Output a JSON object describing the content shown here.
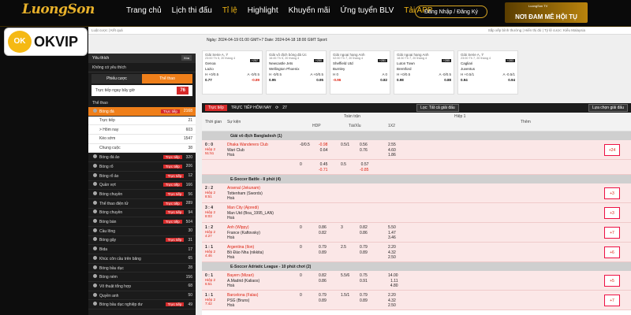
{
  "brand": {
    "logo": "LuongSon",
    "okvip": "OKVIP",
    "okvip_badge": "OK"
  },
  "nav": {
    "items": [
      "Trang chủ",
      "Lịch thi đấu",
      "Tỉ lệ",
      "Highlight",
      "Khuyến mãi",
      "Ứng tuyển BLV",
      "Tải APP"
    ],
    "active": "Tỉ lệ",
    "app_badge": "HOT",
    "login": "Đăng Nhập / Đăng Ký",
    "promo_small": "LuongSon TV",
    "promo": "NƠI ĐAM MÊ HỘI TỤ"
  },
  "breadcrumb": {
    "left": "Luật cược | Kết quả",
    "right": "Sắp xếp bình thường | Hiển thị đủ | Tỷ lệ cược: Kiểu Malaysia"
  },
  "dates": "Ngày: 2024-04-19 01:00 GMT+7 Date: 2024-04-18 18:00 GMT Sport:",
  "sidebar": {
    "fav": "Yêu thích",
    "close": "Xóa",
    "fav_none": "Không có yêu thích",
    "tabs": [
      "Phiếu cược",
      "Thể thao"
    ],
    "live_label": "Trực tiếp ngay bây giờ",
    "live_count": "76",
    "section": "Thể thao",
    "rows": [
      {
        "name": "Bóng đá",
        "tag": "Trực tiếp",
        "count": "2168",
        "sel": true
      },
      {
        "name": "Trực tiếp",
        "count": "21",
        "sub": true
      },
      {
        "name": "> Hôm nay",
        "count": "603",
        "sub": true
      },
      {
        "name": "Kèo sớm",
        "count": "1547",
        "sub": true
      },
      {
        "name": "Chung cuộc",
        "count": "38",
        "sub": true
      },
      {
        "name": "Bóng đá ảo",
        "tag": "Trực tiếp",
        "count": "320"
      },
      {
        "name": "Bóng rổ",
        "tag": "Trực tiếp",
        "count": "206"
      },
      {
        "name": "Bóng rổ ảo",
        "tag": "Trực tiếp",
        "count": "12"
      },
      {
        "name": "Quần vợt",
        "tag": "Trực tiếp",
        "count": "166"
      },
      {
        "name": "Bóng chuyền",
        "tag": "Trực tiếp",
        "count": "56"
      },
      {
        "name": "Thể thao điện tử",
        "tag": "Trực tiếp",
        "count": "289"
      },
      {
        "name": "Bóng chuyền",
        "tag": "Trực tiếp",
        "count": "94"
      },
      {
        "name": "Bóng bàn",
        "tag": "Trực tiếp",
        "count": "504"
      },
      {
        "name": "Cầu lông",
        "count": "30"
      },
      {
        "name": "Bóng gậy",
        "tag": "Trực tiếp",
        "count": "31"
      },
      {
        "name": "Bida",
        "count": "17"
      },
      {
        "name": "Khúc côn cầu trên băng",
        "count": "65"
      },
      {
        "name": "Bóng bầu dục",
        "count": "28"
      },
      {
        "name": "Bóng ném",
        "count": "156"
      },
      {
        "name": "Võ thuật tổng hợp",
        "count": "68"
      },
      {
        "name": "Quyền anh",
        "count": "50"
      },
      {
        "name": "Bóng bầu dục nghiệp dư",
        "tag": "Trực tiếp",
        "count": "49"
      }
    ]
  },
  "cards": [
    {
      "league": "Giải Serie A, Ý",
      "time": "23:00 Th 5, 20 tháng 4",
      "badge": "+257",
      "home": "Genoa",
      "away": "Lazio",
      "h": "H +0/0.5",
      "hv": "0.77",
      "a": "A -0/0.5",
      "av": "-0.89"
    },
    {
      "league": "Giải vô địch bóng đá Úc",
      "time": "16:45 Th 5, 20 tháng 4",
      "badge": "+250",
      "home": "Newcastle Jets",
      "away": "Wellington Phoenix",
      "h": "H -0/0.5",
      "hv": "0.95",
      "a": "A +0/0.5",
      "av": "0.95"
    },
    {
      "league": "Giải ngoại hạng Anh",
      "time": "02:00 Th 7, 20 tháng 4",
      "badge": "+281",
      "home": "Sheffield Utd",
      "away": "Burnley",
      "h": "H 0",
      "hv": "-0.96",
      "a": "A 0",
      "av": "0.82"
    },
    {
      "league": "Giải ngoại hạng Anh",
      "time": "18:30 Th 7, 20 tháng 4",
      "badge": "+285",
      "home": "Luton Town",
      "away": "Brentford",
      "h": "H +0/0.5",
      "hv": "0.98",
      "a": "A -0/0.5",
      "av": "0.88"
    },
    {
      "league": "Giải Serie A, Ý",
      "time": "23:00 Th 7, 20 tháng 4",
      "badge": "+283",
      "home": "Cagliari",
      "away": "Juventus",
      "h": "H +0.5/1",
      "hv": "0.94",
      "a": "A -0.5/1",
      "av": "0.94"
    }
  ],
  "table": {
    "live": "Trực tiếp",
    "today": "TRỰC TIẾP HÔM NAY",
    "count": "27",
    "filter": "Lọc: Tất cả giải đấu",
    "select": "Lựa chọn giải đấu",
    "cols": {
      "time": "Thời gian",
      "event": "Sự kiện",
      "full": "Toàn trận",
      "half": "Hiệp 1",
      "hdp": "HDP",
      "ou": "Tài/Xỉu",
      "x12": "1X2",
      "more": "Thêm"
    },
    "groups": [
      {
        "league": "Giải vô địch Bangladesh (1)",
        "matches": [
          {
            "score": "0 : 0",
            "status": "Hiệp 2",
            "minute": "51:51",
            "home": "Dhaka Wanderers Club",
            "away": "Wari Club",
            "draw": "Hoà",
            "hdp": "-0/0.5",
            "hdp_v": [
              "-0.98",
              "0.64"
            ],
            "ou": "0.5/1",
            "ou_v": [
              "0.56",
              "0.76"
            ],
            "x": [
              "2.55",
              "4.60",
              "1.86"
            ],
            "more": "+24"
          },
          {
            "score": "",
            "status": "",
            "minute": "",
            "home": "",
            "away": "",
            "draw": "",
            "hdp": "0",
            "hdp_v": [
              "0.45",
              "-0.71"
            ],
            "ou": "0.5",
            "ou_v": [
              "0.57",
              "-0.85"
            ],
            "x": [
              "",
              "",
              ""
            ],
            "more": ""
          }
        ]
      },
      {
        "league": "E-Soccer Battle - 8 phút (4)",
        "matches": [
          {
            "score": "2 : 2",
            "status": "Hiệp 2",
            "minute": "8:51",
            "home": "Arsenal (Jekunam)",
            "away": "Tottenham (Swords)",
            "draw": "Hoà",
            "hdp": "",
            "hdp_v": [
              "",
              ""
            ],
            "ou": "",
            "ou_v": [
              "",
              ""
            ],
            "x": [
              "",
              "",
              ""
            ],
            "more": "+3"
          },
          {
            "score": "3 : 4",
            "status": "Hiệp 2",
            "minute": "8:03",
            "home": "Man City (Ajoredi)",
            "away": "Man Utd (Boa_1995_LAN)",
            "draw": "Hoà",
            "hdp": "",
            "hdp_v": [
              "",
              ""
            ],
            "ou": "",
            "ou_v": [
              "",
              ""
            ],
            "x": [
              "",
              "",
              ""
            ],
            "more": "+3"
          },
          {
            "score": "1 : 2",
            "status": "Hiệp 2",
            "minute": "4:27",
            "home": "Anh (Wlppy)",
            "away": "France (Kaftovsky)",
            "draw": "Hoà",
            "hdp": "0",
            "hdp_v": [
              "0.86",
              "0.82"
            ],
            "ou": "3",
            "ou_v": [
              "0.82",
              "0.86"
            ],
            "x": [
              "5.50",
              "1.47",
              "3.46"
            ],
            "more": "+7"
          },
          {
            "score": "1 : 1",
            "status": "Hiệp 2",
            "minute": "4:46",
            "home": "Argentina (Ilon)",
            "away": "Bồ Đào Nha (nikkita)",
            "draw": "Hoà",
            "hdp": "0",
            "hdp_v": [
              "0.79",
              "0.89"
            ],
            "ou": "2.5",
            "ou_v": [
              "0.79",
              "0.89"
            ],
            "x": [
              "2.20",
              "4.32",
              "2.50"
            ],
            "more": "+6"
          }
        ]
      },
      {
        "league": "E-Soccer Adriatic League - 10 phút chơi (2)",
        "matches": [
          {
            "score": "0 : 1",
            "status": "Hiệp 2",
            "minute": "6:51",
            "home": "Bayern (Mizari)",
            "away": "A.Madrid (Kaliaos)",
            "draw": "Hoà",
            "hdp": "0",
            "hdp_v": [
              "0.82",
              "0.86"
            ],
            "ou": "5.5/6",
            "ou_v": [
              "0.75",
              "0.91"
            ],
            "x": [
              "14.00",
              "1.11",
              "4.80"
            ],
            "more": "+5"
          },
          {
            "score": "1 : 1",
            "status": "Hiệp 2",
            "minute": "7:42",
            "home": "Barcelona (Falas)",
            "away": "PSG (Bruns)",
            "draw": "Hoà",
            "hdp": "0",
            "hdp_v": [
              "0.79",
              "0.89"
            ],
            "ou": "1.5/1",
            "ou_v": [
              "0.79",
              "0.89"
            ],
            "x": [
              "2.20",
              "4.32",
              "2.50"
            ],
            "more": "+7"
          }
        ]
      }
    ]
  }
}
